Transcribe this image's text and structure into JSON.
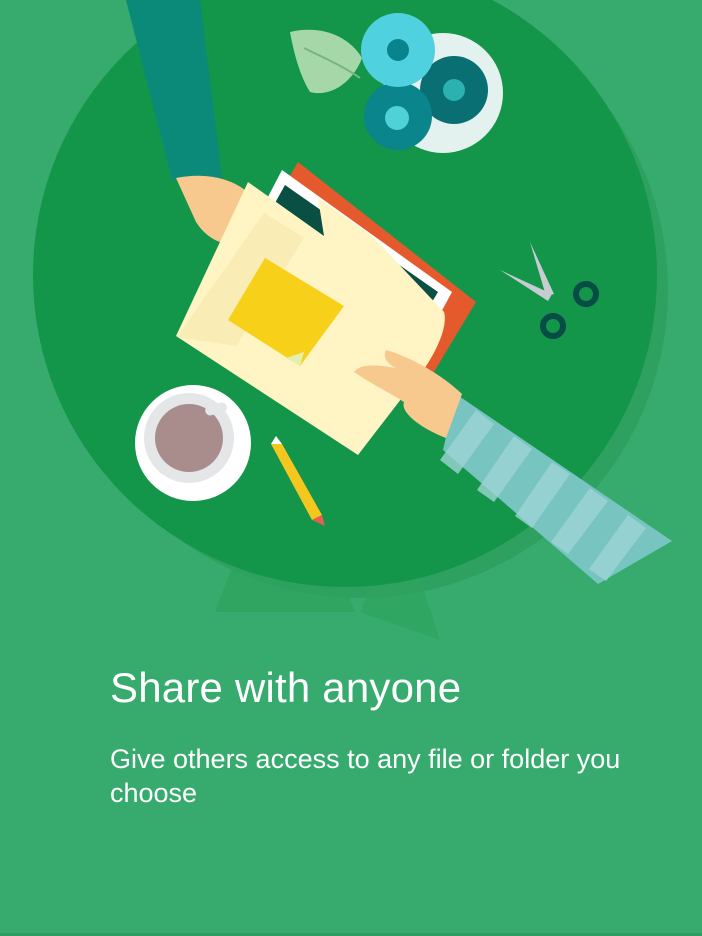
{
  "onboarding": {
    "title": "Share with anyone",
    "description": "Give others access to any file or folder you choose",
    "illustration_icons": [
      "table-illustration",
      "hand-left-icon",
      "hand-right-icon",
      "folder-icon",
      "sticky-note-icon",
      "gears-icon",
      "scissors-icon",
      "coffee-cup-icon",
      "pencil-icon"
    ]
  },
  "colors": {
    "background": "#36ab6d",
    "table": "#13954a",
    "text": "#ffffff"
  }
}
